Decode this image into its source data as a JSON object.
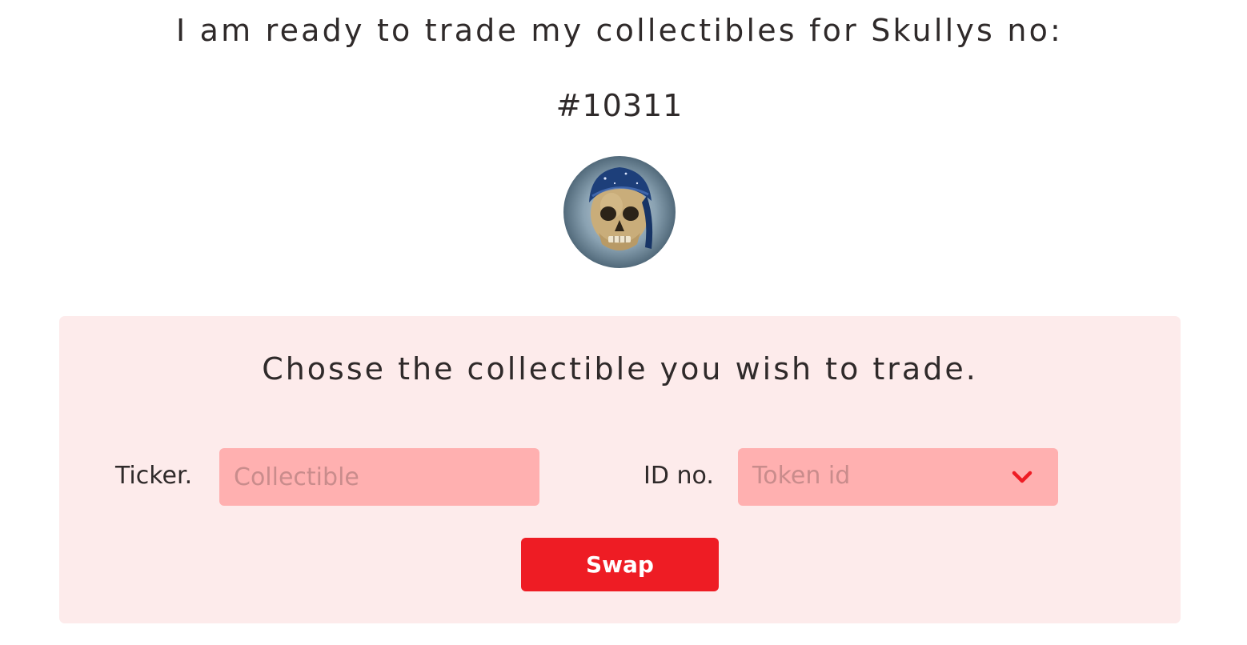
{
  "header": {
    "headline": "I am ready to trade my collectibles for Skullys no:",
    "skully_number": "#10311"
  },
  "avatar": {
    "icon": "skull-with-bandana-icon"
  },
  "trade_panel": {
    "title": "Chosse the collectible you wish to trade.",
    "ticker_label": "Ticker.",
    "ticker_placeholder": "Collectible",
    "id_label": "ID no.",
    "id_placeholder": "Token id",
    "swap_label": "Swap"
  },
  "colors": {
    "panel_background": "#fdebeb",
    "input_background": "#ffb0b0",
    "accent": "#ee1c24",
    "text": "#2f2a2a"
  }
}
